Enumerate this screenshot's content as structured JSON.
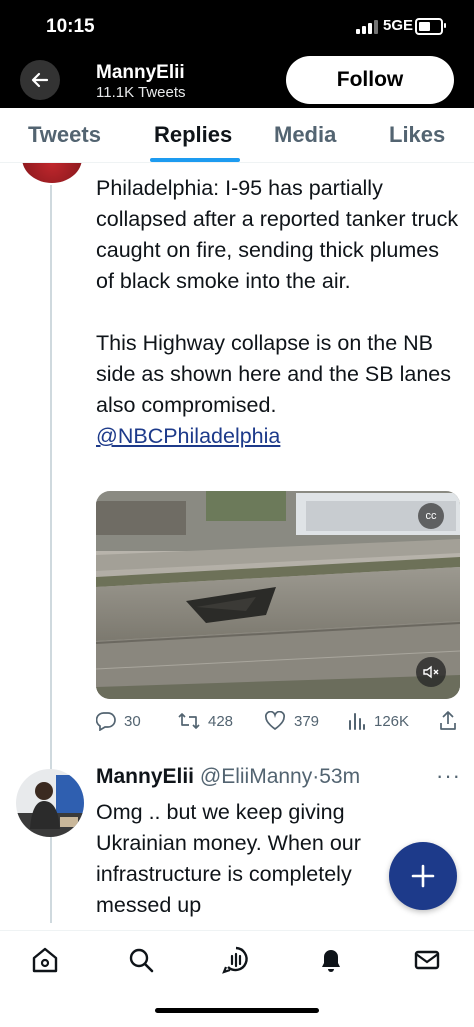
{
  "status_bar": {
    "time": "10:15",
    "network": "5GE"
  },
  "header": {
    "name": "MannyElii",
    "tweet_count": "11.1K Tweets",
    "follow_label": "Follow"
  },
  "tabs": [
    {
      "label": "Tweets"
    },
    {
      "label": "Replies"
    },
    {
      "label": "Media"
    },
    {
      "label": "Likes"
    }
  ],
  "active_tab": "Replies",
  "tweet": {
    "paragraph1": "Philadelphia: I-95 has partially collapsed after a reported tanker truck caught on fire, sending thick plumes of black smoke into the air.",
    "paragraph2": "This Highway collapse is on the NB side as shown here and the SB lanes also compromised.",
    "mention": "@NBCPhiladelphia",
    "media_badge": "cc",
    "actions": {
      "replies": "30",
      "retweets": "428",
      "likes": "379",
      "views": "126K"
    }
  },
  "reply": {
    "name": "MannyElii",
    "handle": "@EliiManny",
    "time": "·53m",
    "more": "···",
    "text": "Omg .. but we keep giving Ukrainian money. When our infrastructure is completely messed up"
  },
  "icons": {
    "back": "arrow-left-icon",
    "fab": "plus-icon",
    "nav": [
      "home-icon",
      "search-icon",
      "spaces-icon",
      "notifications-icon",
      "messages-icon"
    ]
  },
  "colors": {
    "accent": "#1d3a8a",
    "link": "#1d3a8a",
    "text": "#0f1419",
    "secondary": "#536471"
  }
}
